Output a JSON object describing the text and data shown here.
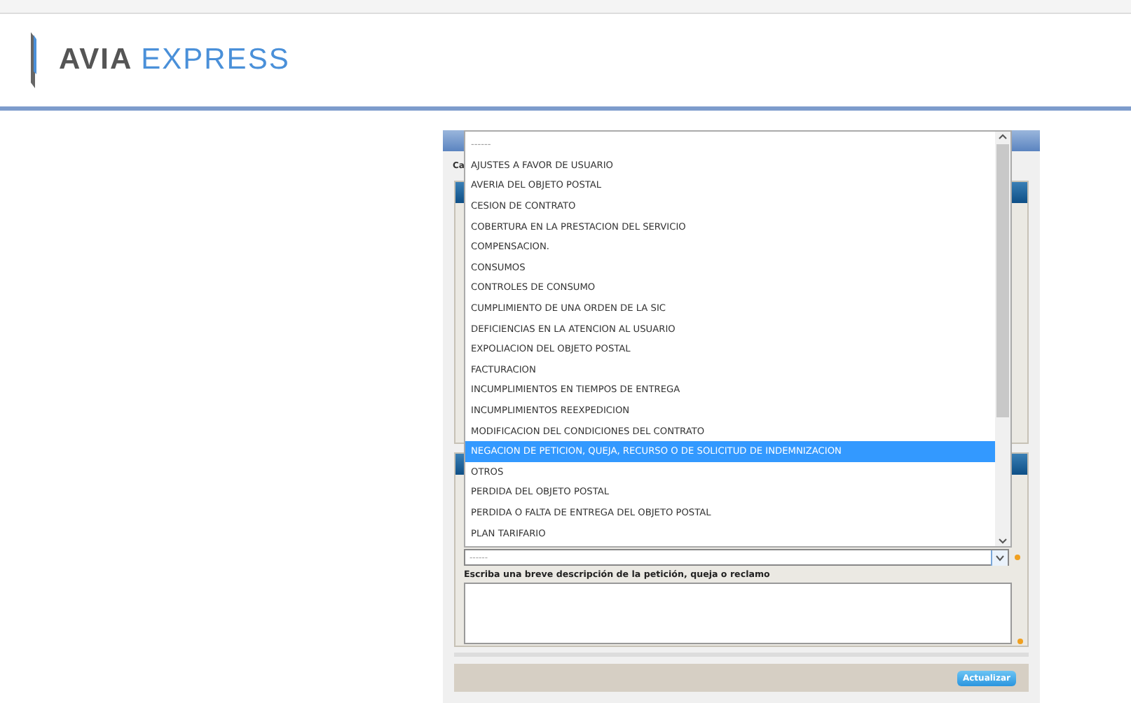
{
  "header": {
    "brand_bold": "AVIA",
    "brand_light": "EXPRESS"
  },
  "form": {
    "label_fragment": "Ca",
    "dropdown": {
      "options": [
        {
          "label": "------",
          "selected": false
        },
        {
          "label": "AJUSTES A FAVOR DE USUARIO",
          "selected": false
        },
        {
          "label": "AVERIA DEL OBJETO POSTAL",
          "selected": false
        },
        {
          "label": "CESION DE CONTRATO",
          "selected": false
        },
        {
          "label": "COBERTURA EN LA PRESTACION DEL SERVICIO",
          "selected": false
        },
        {
          "label": "COMPENSACION.",
          "selected": false
        },
        {
          "label": "CONSUMOS",
          "selected": false
        },
        {
          "label": "CONTROLES DE CONSUMO",
          "selected": false
        },
        {
          "label": "CUMPLIMIENTO DE UNA ORDEN DE LA SIC",
          "selected": false
        },
        {
          "label": "DEFICIENCIAS EN LA ATENCION AL USUARIO",
          "selected": false
        },
        {
          "label": "EXPOLIACION DEL OBJETO POSTAL",
          "selected": false
        },
        {
          "label": "FACTURACION",
          "selected": false
        },
        {
          "label": "INCUMPLIMIENTOS EN TIEMPOS DE ENTREGA",
          "selected": false
        },
        {
          "label": "INCUMPLIMIENTOS REEXPEDICION",
          "selected": false
        },
        {
          "label": "MODIFICACION DEL CONDICIONES DEL CONTRATO",
          "selected": false
        },
        {
          "label": "NEGACION DE PETICION, QUEJA, RECURSO O DE SOLICITUD DE INDEMNIZACION",
          "selected": true
        },
        {
          "label": "OTROS",
          "selected": false
        },
        {
          "label": "PERDIDA DEL OBJETO POSTAL",
          "selected": false
        },
        {
          "label": "PERDIDA O FALTA DE ENTREGA DEL OBJETO POSTAL",
          "selected": false
        },
        {
          "label": "PLAN TARIFARIO",
          "selected": false
        }
      ]
    },
    "select": {
      "value": "------"
    },
    "description_label": "Escriba una breve descripción de la petición, queja o reclamo",
    "button": "Actualizar"
  }
}
